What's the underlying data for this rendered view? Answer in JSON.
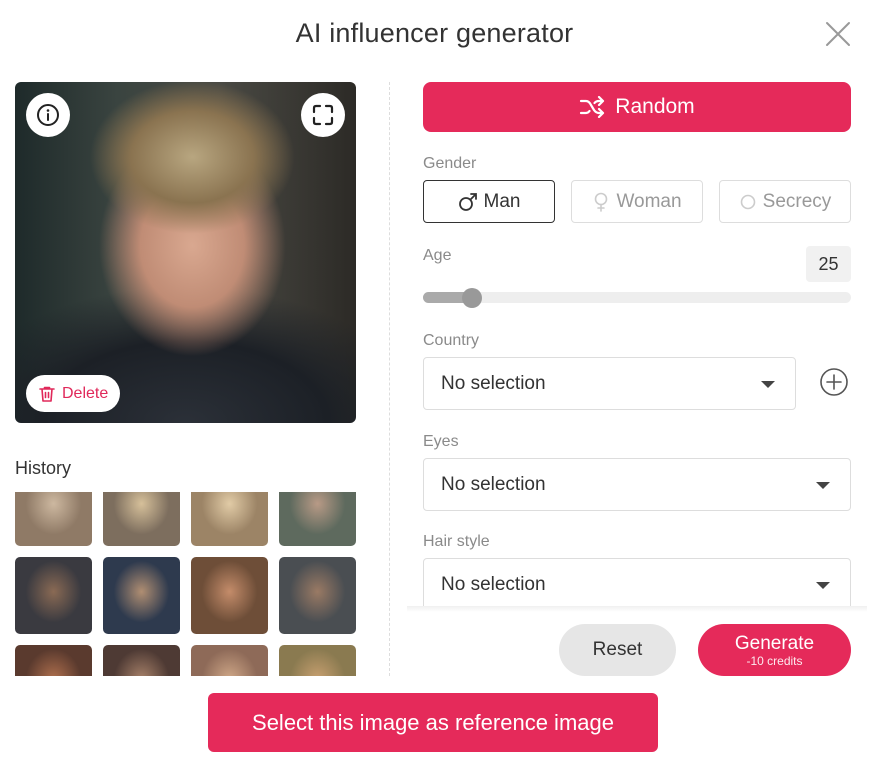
{
  "dialog": {
    "title": "AI influencer generator"
  },
  "preview": {
    "delete_label": "Delete"
  },
  "history": {
    "label": "History",
    "thumbnails": [
      {
        "colors": [
          "#cdb8a0",
          "#8f7a66"
        ]
      },
      {
        "colors": [
          "#d6c09a",
          "#7d6e5e"
        ]
      },
      {
        "colors": [
          "#e1cba6",
          "#9c8466"
        ]
      },
      {
        "colors": [
          "#b89a86",
          "#5e6a5e"
        ]
      },
      {
        "colors": [
          "#8a6a54",
          "#3a3a40"
        ]
      },
      {
        "colors": [
          "#b08e72",
          "#2e3a4e"
        ]
      },
      {
        "colors": [
          "#c48c6a",
          "#6e4e38"
        ]
      },
      {
        "colors": [
          "#9a7a64",
          "#4a4e52"
        ]
      },
      {
        "colors": [
          "#b0704e",
          "#5a3a2e"
        ]
      },
      {
        "colors": [
          "#a8826a",
          "#4e3a34"
        ]
      },
      {
        "colors": [
          "#d0a888",
          "#8e6a58"
        ]
      },
      {
        "colors": [
          "#c8a070",
          "#8a7a50"
        ]
      }
    ]
  },
  "controls": {
    "random_label": "Random",
    "gender": {
      "label": "Gender",
      "options": [
        {
          "label": "Man",
          "selected": true
        },
        {
          "label": "Woman",
          "selected": false
        },
        {
          "label": "Secrecy",
          "selected": false
        }
      ]
    },
    "age": {
      "label": "Age",
      "value": "25",
      "fraction": 0.115
    },
    "country": {
      "label": "Country",
      "value": "No selection"
    },
    "eyes": {
      "label": "Eyes",
      "value": "No selection"
    },
    "hair_style": {
      "label": "Hair style",
      "value": "No selection"
    }
  },
  "footer": {
    "reset_label": "Reset",
    "generate_label": "Generate",
    "generate_cost": "-10 credits",
    "select_reference_label": "Select this image as reference image"
  },
  "colors": {
    "accent": "#e52a5a"
  }
}
